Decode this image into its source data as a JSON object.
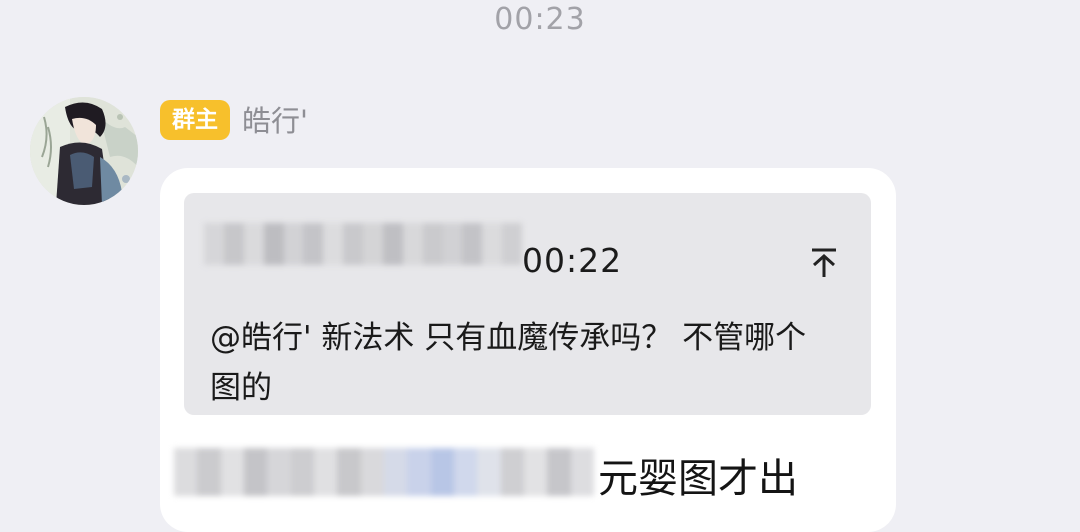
{
  "header": {
    "timestamp": "00:23"
  },
  "message": {
    "avatar_icon": "anime-character-avatar-icon",
    "role_badge": "群主",
    "role_badge_color": "#f7c02c",
    "sender_name": "皓行'",
    "quote": {
      "time": "00:22",
      "text": "@皓行' 新法术 只有血魔传承吗？ 不管哪个图的",
      "jump_icon": "arrow-up-to-top-icon"
    },
    "reply_text": "元婴图才出"
  },
  "colors": {
    "background": "#efeff4",
    "bubble": "#ffffff",
    "quote_box": "#e7e7ea"
  }
}
